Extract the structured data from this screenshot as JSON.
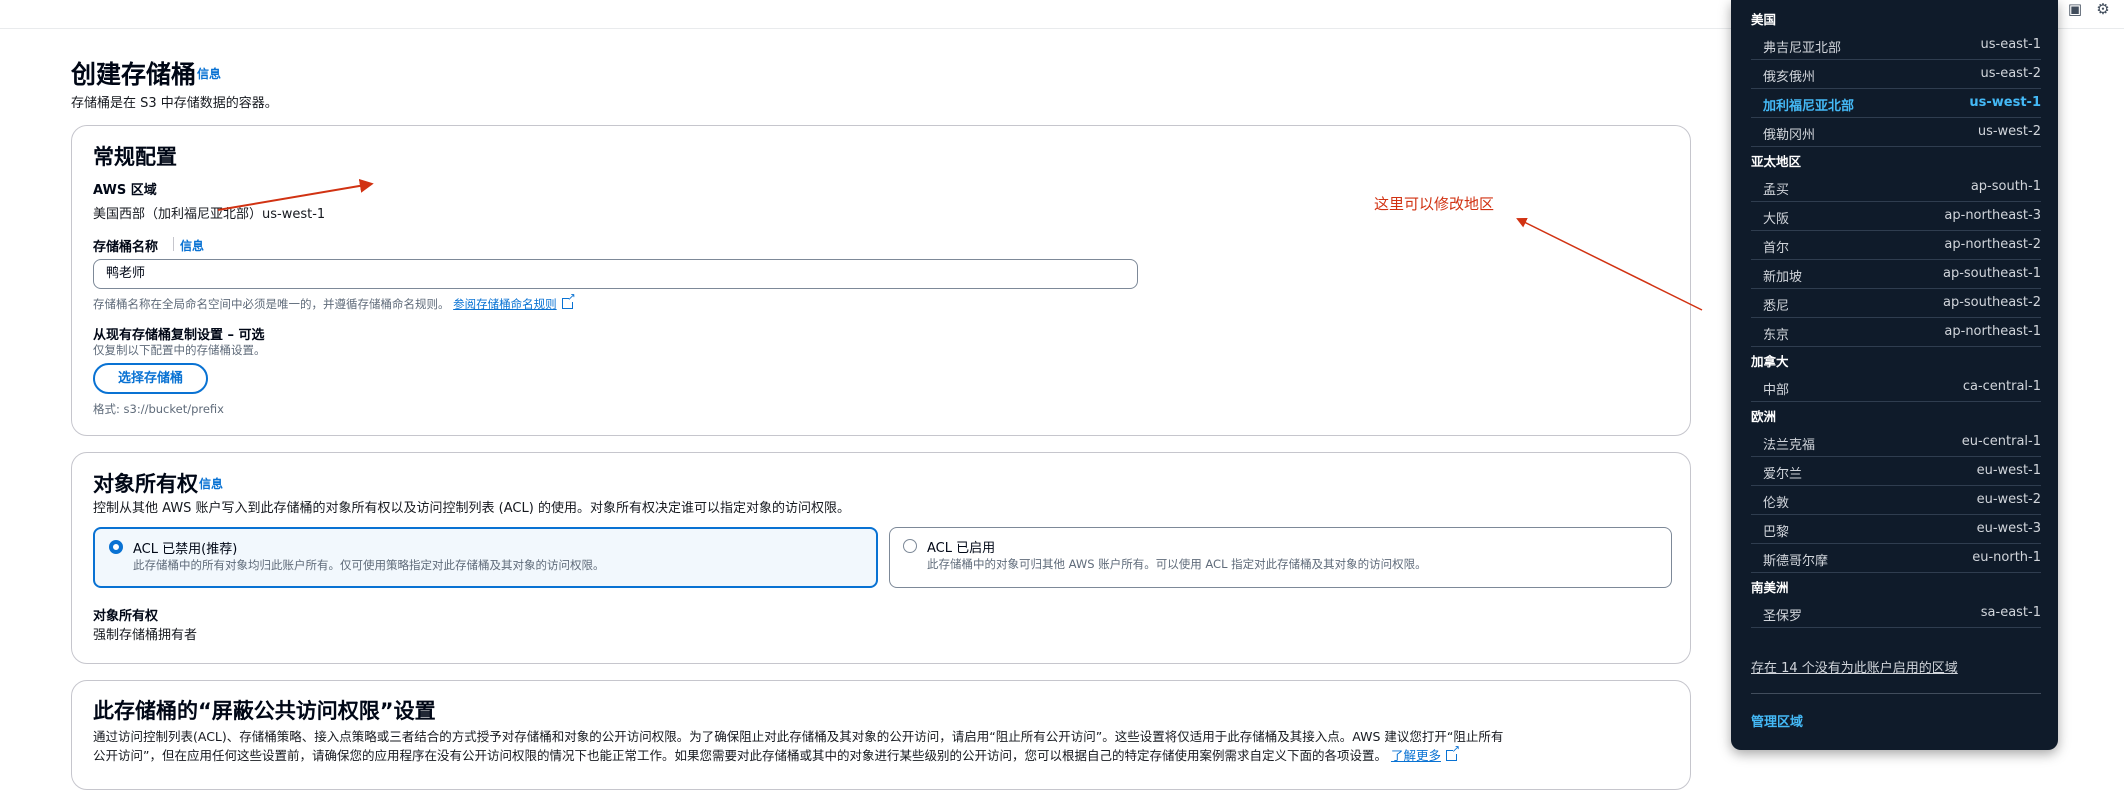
{
  "page": {
    "title": "创建存储桶",
    "info": "信息",
    "subtitle": "存储桶是在 S3 中存储数据的容器。"
  },
  "general": {
    "heading": "常规配置",
    "region_label": "AWS 区域",
    "region_value": "美国西部（加利福尼亚北部）us-west-1",
    "bucket_name_label": "存储桶名称",
    "bucket_name_info": "信息",
    "bucket_name_value": "鸭老师",
    "bucket_name_hint": "存储桶名称在全局命名空间中必须是唯一的，并遵循存储桶命名规则。",
    "naming_rules_link": "参阅存储桶命名规则",
    "copy_label": "从现有存储桶复制设置 – 可选",
    "copy_hint": "仅复制以下配置中的存储桶设置。",
    "choose_bucket_button": "选择存储桶",
    "format_hint": "格式: s3://bucket/prefix"
  },
  "ownership": {
    "heading": "对象所有权",
    "info": "信息",
    "description": "控制从其他 AWS 账户写入到此存储桶的对象所有权以及访问控制列表 (ACL) 的使用。对象所有权决定谁可以指定对象的访问权限。",
    "option_disabled_title": "ACL 已禁用(推荐)",
    "option_disabled_desc": "此存储桶中的所有对象均归此账户所有。仅可使用策略指定对此存储桶及其对象的访问权限。",
    "option_enabled_title": "ACL 已启用",
    "option_enabled_desc": "此存储桶中的对象可归其他 AWS 账户所有。可以使用 ACL 指定对此存储桶及其对象的访问权限。",
    "owner_label": "对象所有权",
    "owner_value": "强制存储桶拥有者"
  },
  "public_access": {
    "heading": "此存储桶的“屏蔽公共访问权限”设置",
    "desc_line1": "通过访问控制列表(ACL)、存储桶策略、接入点策略或三者结合的方式授予对存储桶和对象的公开访问权限。为了确保阻止对此存储桶及其对象的公开访问，请启用“阻止所有公开访问”。这些设置将仅适用于此存储桶及其接入点。AWS 建议您打开“阻止所有",
    "desc_line2": "公开访问”，但在应用任何这些设置前，请确保您的应用程序在没有公开访问权限的情况下也能正常工作。如果您需要对此存储桶或其中的对象进行某些级别的公开访问，您可以根据自己的特定存储使用案例需求自定义下面的各项设置。",
    "learn_more": "了解更多"
  },
  "annotation": {
    "text": "这里可以修改地区",
    "color": "#d13212"
  },
  "region_dropdown": {
    "groups": [
      {
        "name": "美国",
        "options": [
          {
            "label": "弗吉尼亚北部",
            "code": "us-east-1"
          },
          {
            "label": "俄亥俄州",
            "code": "us-east-2"
          },
          {
            "label": "加利福尼亚北部",
            "code": "us-west-1",
            "selected": true
          },
          {
            "label": "俄勒冈州",
            "code": "us-west-2"
          }
        ]
      },
      {
        "name": "亚太地区",
        "options": [
          {
            "label": "孟买",
            "code": "ap-south-1"
          },
          {
            "label": "大阪",
            "code": "ap-northeast-3"
          },
          {
            "label": "首尔",
            "code": "ap-northeast-2"
          },
          {
            "label": "新加坡",
            "code": "ap-southeast-1"
          },
          {
            "label": "悉尼",
            "code": "ap-southeast-2"
          },
          {
            "label": "东京",
            "code": "ap-northeast-1"
          }
        ]
      },
      {
        "name": "加拿大",
        "options": [
          {
            "label": "中部",
            "code": "ca-central-1"
          }
        ]
      },
      {
        "name": "欧洲",
        "options": [
          {
            "label": "法兰克福",
            "code": "eu-central-1"
          },
          {
            "label": "爱尔兰",
            "code": "eu-west-1"
          },
          {
            "label": "伦敦",
            "code": "eu-west-2"
          },
          {
            "label": "巴黎",
            "code": "eu-west-3"
          },
          {
            "label": "斯德哥尔摩",
            "code": "eu-north-1"
          }
        ]
      },
      {
        "name": "南美洲",
        "options": [
          {
            "label": "圣保罗",
            "code": "sa-east-1"
          }
        ]
      }
    ],
    "disabled_note": "存在 14 个没有为此账户启用的区域",
    "manage_link": "管理区域"
  },
  "colors": {
    "accent": "#0972d3",
    "dropdown_bg": "#0f1b2a",
    "selected_option": "#44b9f6"
  }
}
